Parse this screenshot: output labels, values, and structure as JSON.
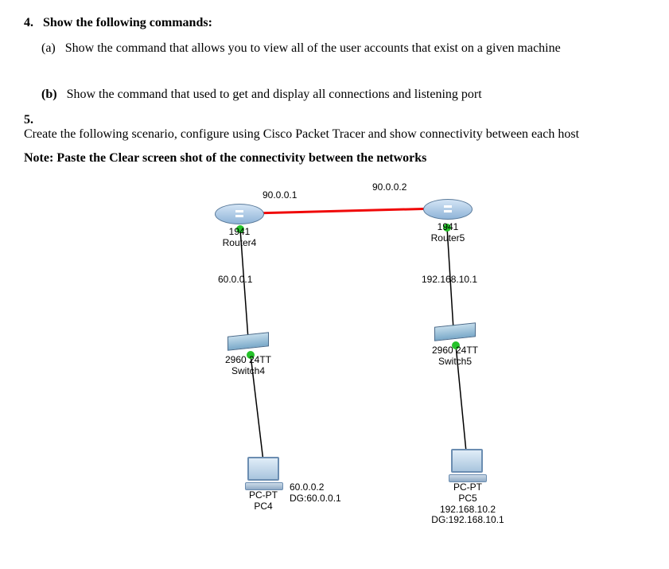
{
  "q4": {
    "number": "4.",
    "heading": "Show the following commands:",
    "a_label": "(a)",
    "a_text": "Show the command that allows you to view all of the user accounts that exist on a given machine",
    "b_label": "(b)",
    "b_text": "Show the command that used to get and display all connections and listening port"
  },
  "q5": {
    "number": "5.",
    "text": "Create the following scenario, configure using Cisco Packet Tracer and show connectivity between each host"
  },
  "note": "Note: Paste the Clear screen shot of the connectivity between the networks",
  "diagram": {
    "router4": {
      "ip": "90.0.0.1",
      "model": "1941",
      "name": "Router4",
      "lan_ip": "60.0.0.1"
    },
    "router5": {
      "ip": "90.0.0.2",
      "model": "1941",
      "name": "Router5",
      "lan_ip": "192.168.10.1"
    },
    "switch4": {
      "model": "2960 24TT",
      "name": "Switch4"
    },
    "switch5": {
      "model": "2960 24TT",
      "name": "Switch5"
    },
    "pc4": {
      "type": "PC-PT",
      "name": "PC4",
      "ip": "60.0.0.2",
      "dg": "DG:60.0.0.1"
    },
    "pc5": {
      "type": "PC-PT",
      "name": "PC5",
      "ip": "192.168.10.2",
      "dg": "DG:192.168.10.1"
    }
  }
}
